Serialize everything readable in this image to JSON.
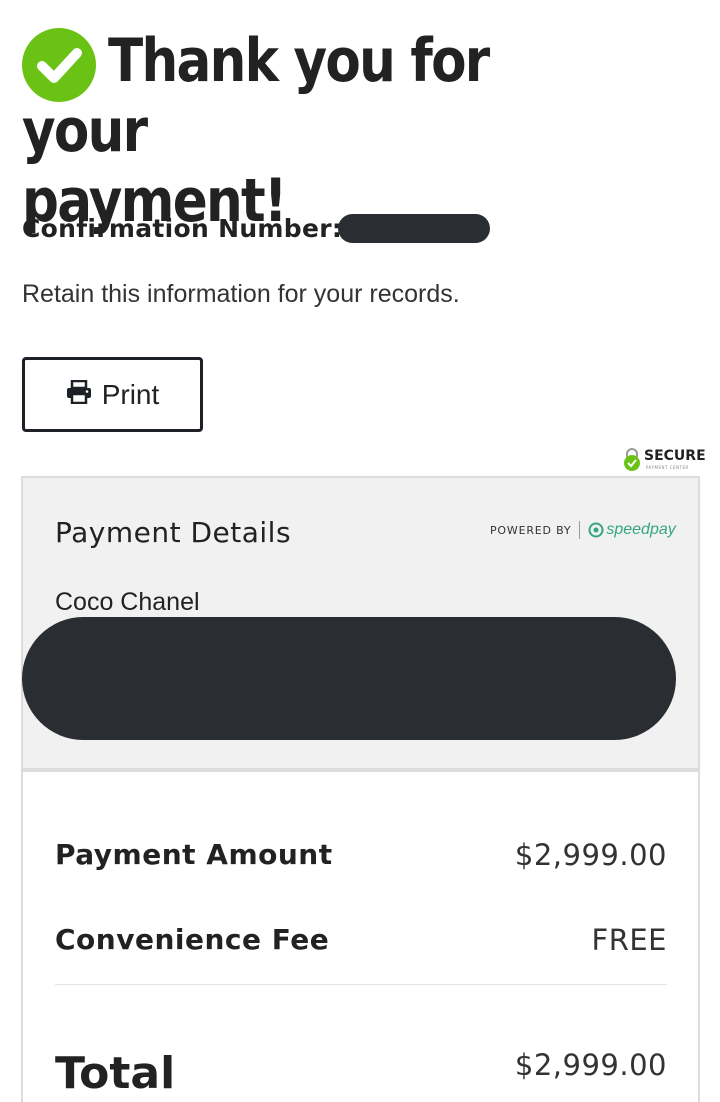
{
  "heading": {
    "line1": "Thank you for your",
    "line2": "payment!"
  },
  "confirmation": {
    "label": "Confirmation Number:",
    "value_redacted": true
  },
  "retain_text": "Retain this information for your records.",
  "print_button": {
    "label": "Print",
    "icon": "printer-icon"
  },
  "secure_badge": {
    "label": "SECURE",
    "sub": "PAYMENT CENTER",
    "icon": "shield-check-icon"
  },
  "details": {
    "title": "Payment Details",
    "powered_by": "POWERED BY",
    "brand": "speedpay",
    "payer_name": "Coco Chanel",
    "address_redacted": true
  },
  "summary": {
    "payment_amount_label": "Payment Amount",
    "payment_amount_value": "$2,999.00",
    "fee_label": "Convenience Fee",
    "fee_value": "FREE",
    "total_label": "Total",
    "total_value": "$2,999.00"
  },
  "colors": {
    "success_green": "#6ac314",
    "redaction": "#2a2e33",
    "brand_teal": "#34a87c",
    "panel_bg": "#f1f1f1"
  }
}
